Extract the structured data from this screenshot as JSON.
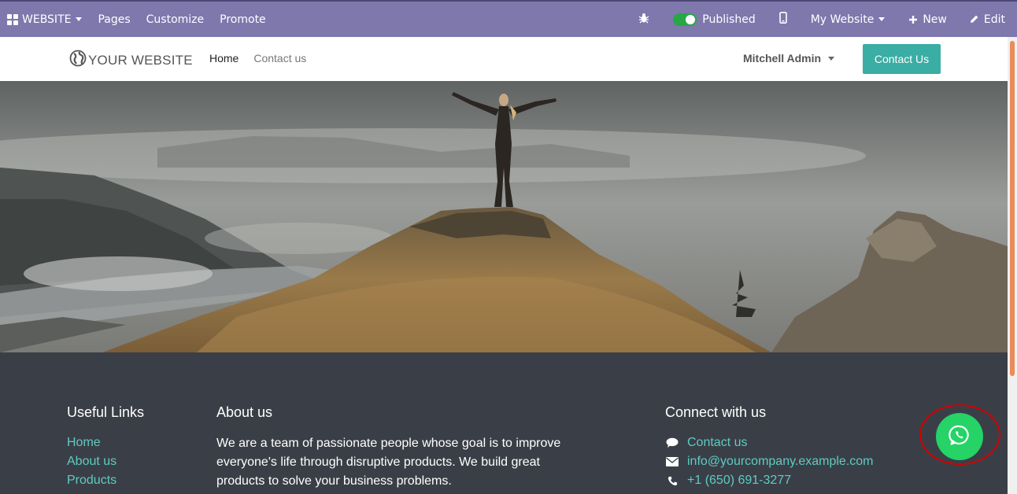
{
  "adminbar": {
    "website_label": "WEBSITE",
    "pages_label": "Pages",
    "customize_label": "Customize",
    "promote_label": "Promote",
    "published_label": "Published",
    "my_website_label": "My Website",
    "new_label": "New",
    "edit_label": "Edit"
  },
  "header": {
    "logo_text": "YOUR WEBSITE",
    "nav": [
      {
        "label": "Home",
        "active": true
      },
      {
        "label": "Contact us",
        "active": false
      }
    ],
    "user_name": "Mitchell Admin",
    "contact_button": "Contact Us"
  },
  "footer": {
    "useful_links": {
      "title": "Useful Links",
      "links": [
        "Home",
        "About us",
        "Products"
      ]
    },
    "about": {
      "title": "About us",
      "text": "We are a team of passionate people whose goal is to improve everyone's life through disruptive products. We build great products to solve your business problems."
    },
    "connect": {
      "title": "Connect with us",
      "contact_link": "Contact us",
      "email": "info@yourcompany.example.com",
      "phone": "+1 (650) 691-3277"
    }
  },
  "colors": {
    "admin_bar": "#7e78ad",
    "accent": "#3aada4",
    "footer_bg": "#3a3f47",
    "link": "#5fcbc2",
    "whatsapp": "#25d366",
    "highlight_ring": "#d40000"
  },
  "icons": {
    "whatsapp": "whatsapp-icon",
    "bug": "bug-icon",
    "mobile": "mobile-icon",
    "plus": "plus-icon",
    "pencil": "pencil-icon",
    "globe": "globe-icon",
    "comment": "comment-icon",
    "envelope": "envelope-icon",
    "phone": "phone-icon"
  }
}
